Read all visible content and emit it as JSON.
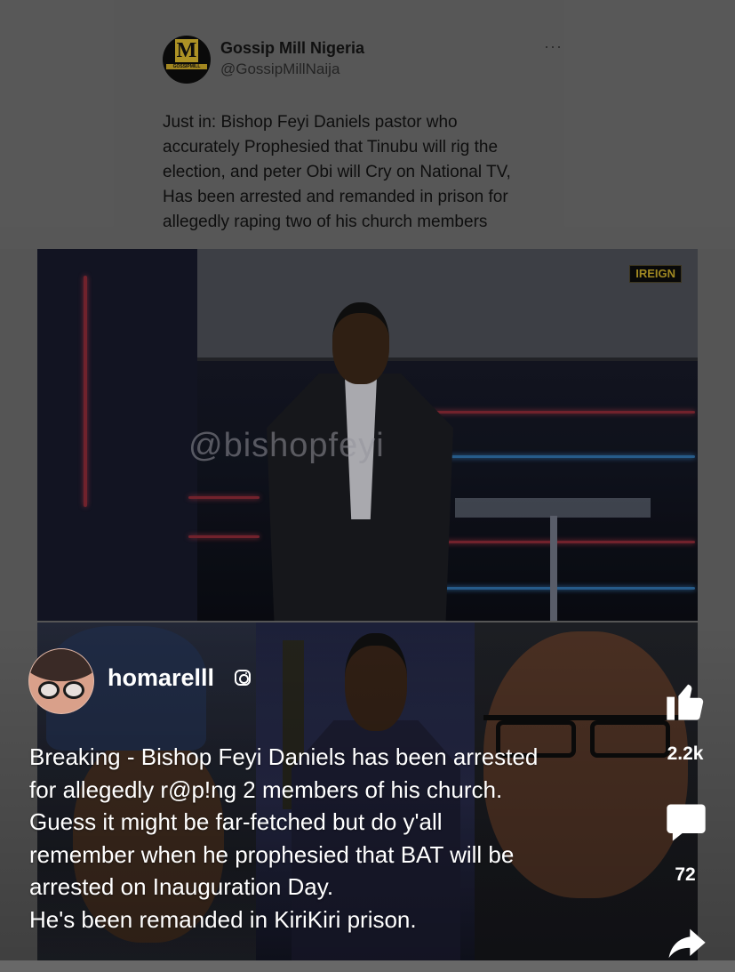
{
  "tweet": {
    "logo_letter": "M",
    "logo_strip": "GOSSIPMILL",
    "name": "Gossip Mill Nigeria",
    "handle": "@GossipMillNaija",
    "more": "···",
    "text_lines": [
      "Just in: Bishop Feyi Daniels pastor who",
      "accurately Prophesied that Tinubu will rig the",
      "election, and peter Obi will Cry on National TV,",
      "Has been arrested and remanded in prison for",
      "allegedly raping two of his church members"
    ]
  },
  "photo": {
    "tag": "IREIGN",
    "watermark": "@bishopfeyi"
  },
  "reel": {
    "author": "homarelll",
    "caption_lines": [
      "Breaking - Bishop Feyi Daniels has been arrested",
      "for allegedly r@p!ng 2 members of his church.",
      "Guess it might be far-fetched but do y'all",
      "remember when he prophesied that BAT will be",
      "arrested on Inauguration Day.",
      "He's been remanded in KiriKiri prison."
    ],
    "likes": "2.2k",
    "comments": "72"
  },
  "icons": {
    "like": "thumbs-up-icon",
    "comment": "comment-bubble-icon",
    "share": "share-arrow-icon",
    "instagram": "instagram-icon"
  },
  "colors": {
    "logo_gold": "#d4b22e",
    "caption_text": "#ffffff"
  }
}
